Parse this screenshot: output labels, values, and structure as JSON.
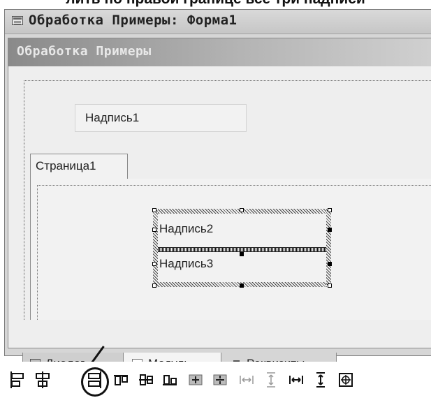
{
  "caption": "лить по правой границе все три надписи",
  "window": {
    "title": "Обработка Примеры: Форма1"
  },
  "form": {
    "header_title": "Обработка  Примеры",
    "label1": "Надпись1",
    "page_tab": "Страница1",
    "label2": "Надпись2",
    "label3": "Надпись3"
  },
  "bottom_tabs": [
    {
      "label": "Диалог",
      "icon": "dialog-icon"
    },
    {
      "label": "Модуль",
      "icon": "module-icon"
    },
    {
      "label": "Реквизиты",
      "icon": "props-icon"
    }
  ],
  "toolbar": {
    "buttons": [
      "align-left-icon",
      "align-center-vertical-icon",
      "align-right-icon",
      "align-top-icon",
      "align-middle-icon",
      "align-bottom-icon",
      "center-horizontal-icon",
      "center-vertical-icon",
      "space-horizontal-icon",
      "space-vertical-icon",
      "equal-width-icon",
      "equal-height-icon",
      "center-both-icon"
    ],
    "highlighted_button": "align-right-icon"
  }
}
